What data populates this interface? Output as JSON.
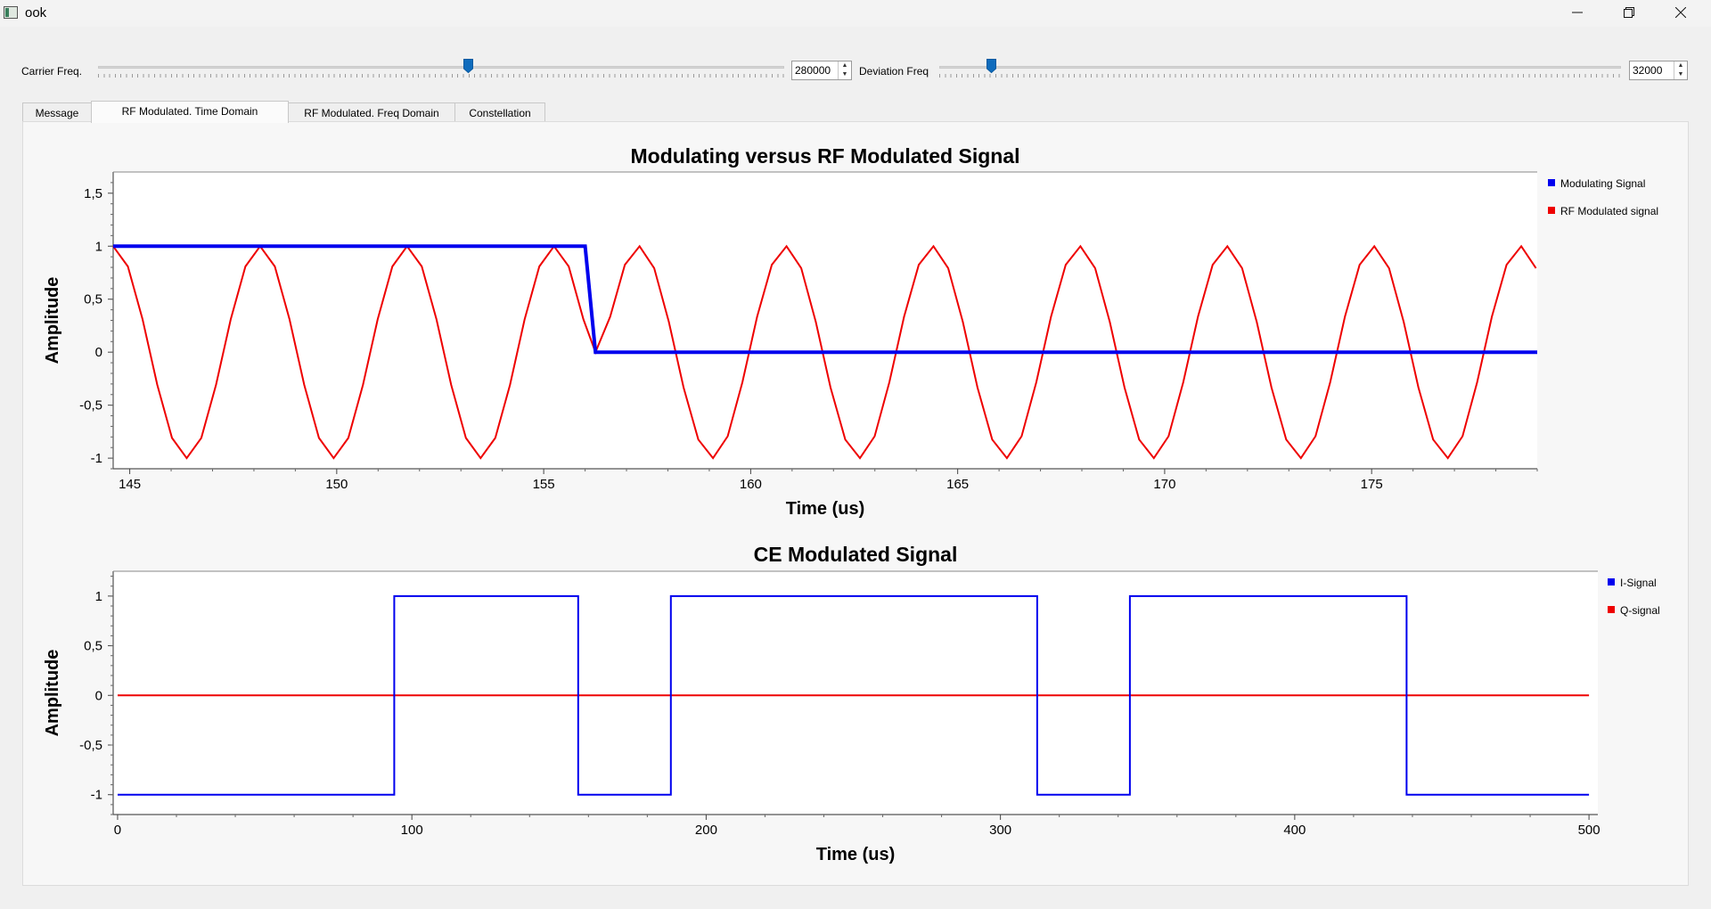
{
  "window": {
    "title": "ook",
    "minimize_icon": "minimize-icon",
    "restore_icon": "restore-icon",
    "close_icon": "close-icon"
  },
  "controls": {
    "carrier": {
      "label": "Carrier Freq.",
      "value": "280000",
      "level": 0.54
    },
    "deviation": {
      "label": "Deviation Freq",
      "value": "32000",
      "level": 0.07
    }
  },
  "tabs": [
    {
      "label": "Message",
      "active": false
    },
    {
      "label": "RF Modulated. Time Domain",
      "active": true
    },
    {
      "label": "RF Modulated. Freq Domain",
      "active": false
    },
    {
      "label": "Constellation",
      "active": false
    }
  ],
  "colors": {
    "blue": "#0000ee",
    "red": "#ee0000",
    "accent": "#0f6cbd"
  },
  "chart_data": [
    {
      "type": "line",
      "title": "Modulating versus RF Modulated Signal",
      "xlabel": "Time (us)",
      "ylabel": "Amplitude",
      "xlim": [
        144.6,
        179
      ],
      "ylim": [
        -1.1,
        1.7
      ],
      "xticks": [
        145,
        150,
        155,
        160,
        165,
        170,
        175
      ],
      "xtick_labels": [
        "145",
        "150",
        "155",
        "160",
        "165",
        "170",
        "175"
      ],
      "yticks": [
        1.5,
        1,
        0.5,
        0,
        -0.5,
        -1
      ],
      "ytick_labels": [
        "1,5",
        "1",
        "0,5",
        "0",
        "-0,5",
        "-1"
      ],
      "legend_position": "right",
      "series": [
        {
          "name": "Modulating Signal",
          "color": "#0000ee",
          "x": [
            144.6,
            156.0,
            156.25,
            179
          ],
          "y": [
            1,
            1,
            0,
            0
          ]
        },
        {
          "name": "RF Modulated signal",
          "color": "#ee0000",
          "period_us": 3.55,
          "sample_step_us": 0.355,
          "peaks_x": [
            144.6,
            148.2,
            151.75,
            155.3,
            157.3,
            160.85,
            164.4,
            167.95,
            171.5,
            175.05,
            178.6
          ],
          "x_end": 179
        }
      ]
    },
    {
      "type": "line",
      "title": "CE Modulated Signal",
      "xlabel": "Time (us)",
      "ylabel": "Amplitude",
      "xlim": [
        -1.5,
        503
      ],
      "ylim": [
        -1.2,
        1.25
      ],
      "xticks": [
        0,
        100,
        200,
        300,
        400,
        500
      ],
      "xtick_labels": [
        "0",
        "100",
        "200",
        "300",
        "400",
        "500"
      ],
      "yticks": [
        1,
        0.5,
        0,
        -0.5,
        -1
      ],
      "ytick_labels": [
        "1",
        "0,5",
        "0",
        "-0,5",
        "-1"
      ],
      "legend_position": "right",
      "series": [
        {
          "name": "I-Signal",
          "color": "#0000ee",
          "x": [
            0,
            94,
            94,
            156.5,
            156.5,
            188,
            188,
            312.5,
            312.5,
            344,
            344,
            438,
            438,
            500
          ],
          "y": [
            -1,
            -1,
            1,
            1,
            -1,
            -1,
            1,
            1,
            -1,
            -1,
            1,
            1,
            -1,
            -1
          ]
        },
        {
          "name": "Q-signal",
          "color": "#ee0000",
          "x": [
            0,
            500
          ],
          "y": [
            0,
            0
          ]
        }
      ]
    }
  ]
}
